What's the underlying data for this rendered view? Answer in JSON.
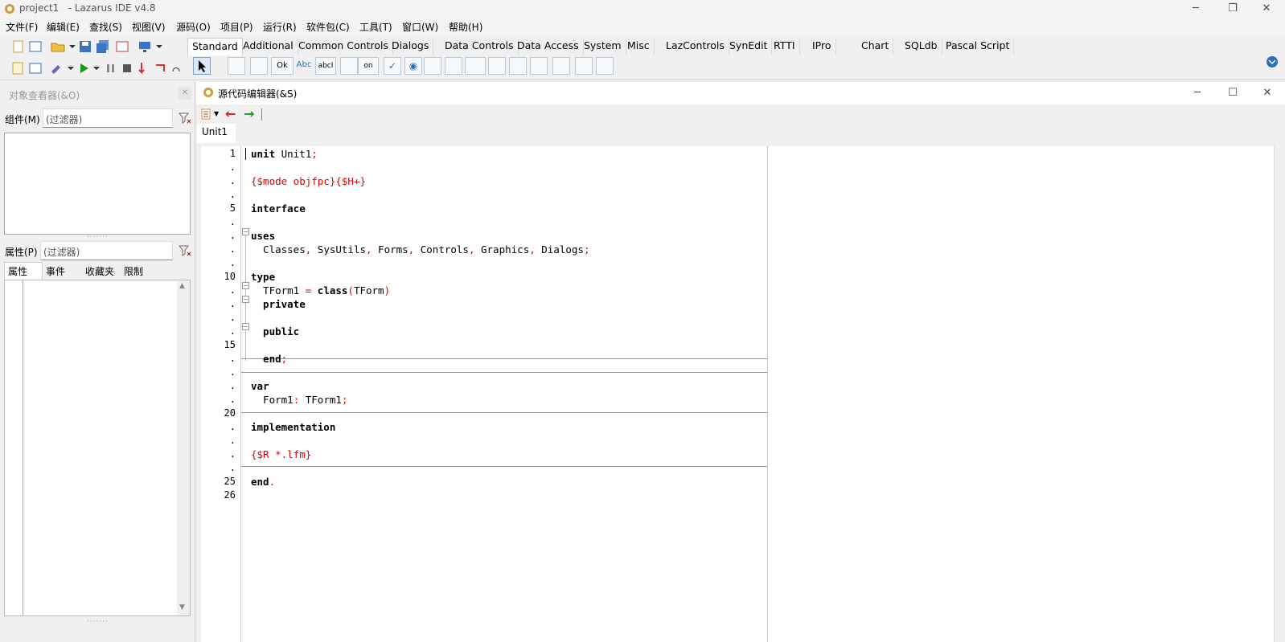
{
  "window": {
    "title": "project1   - Lazarus IDE v4.8",
    "min": "─",
    "max": "❐",
    "close": "✕"
  },
  "menu": [
    "文件(F)",
    "编辑(E)",
    "查找(S)",
    "视图(V)",
    "源码(O)",
    "项目(P)",
    "运行(R)",
    "软件包(C)",
    "工具(T)",
    "窗口(W)",
    "帮助(H)"
  ],
  "palette_tabs": [
    "Standard",
    "Additional",
    "Common Controls",
    "Dialogs",
    "Data Controls",
    "Data Access",
    "System",
    "Misc",
    "LazControls",
    "SynEdit",
    "RTTI",
    "IPro",
    "Chart",
    "SQLdb",
    "Pascal Script"
  ],
  "palette_components": [
    "Ok",
    "Abc",
    "abcI",
    "",
    "on",
    "✓",
    "◉",
    "",
    "",
    "",
    "",
    "",
    "",
    "",
    "",
    ""
  ],
  "object_inspector": {
    "title": "对象查看器(&O)",
    "components_label": "组件(M)",
    "components_filter": "(过滤器)",
    "properties_label": "属性(P)",
    "properties_filter": "(过滤器)",
    "tabs": [
      "属性",
      "事件",
      "收藏夹",
      "限制"
    ]
  },
  "source_editor": {
    "title": "源代码编辑器(&S)",
    "tab": "Unit1",
    "min": "─",
    "max": "☐",
    "close": "✕"
  },
  "line_numbers": [
    "1",
    ".",
    ".",
    ".",
    "5",
    ".",
    ".",
    ".",
    ".",
    "10",
    ".",
    ".",
    ".",
    ".",
    "15",
    ".",
    ".",
    ".",
    ".",
    "20",
    ".",
    ".",
    ".",
    ".",
    "25",
    "26"
  ],
  "code": {
    "l1a": "unit",
    "l1b": " Unit1",
    "l1c": ";",
    "l3": "{$mode objfpc}{$H+}",
    "l5": "interface",
    "l7": "uses",
    "l8a": "  Classes",
    "l8b": ",",
    "l8c": " SysUtils",
    "l8d": ",",
    "l8e": " Forms",
    "l8f": ",",
    "l8g": " Controls",
    "l8h": ",",
    "l8i": " Graphics",
    "l8j": ",",
    "l8k": " Dialogs",
    "l8l": ";",
    "l10": "type",
    "l11a": "  TForm1 ",
    "l11b": "=",
    "l11c": " class",
    "l11d": "(",
    "l11e": "TForm",
    "l11f": ")",
    "l12": "  private",
    "l14": "  public",
    "l16a": "  end",
    "l16b": ";",
    "l18": "var",
    "l19a": "  Form1",
    "l19b": ":",
    "l19c": " TForm1",
    "l19d": ";",
    "l21": "implementation",
    "l23": "{$R *.lfm}",
    "l25a": "end",
    "l25b": "."
  }
}
